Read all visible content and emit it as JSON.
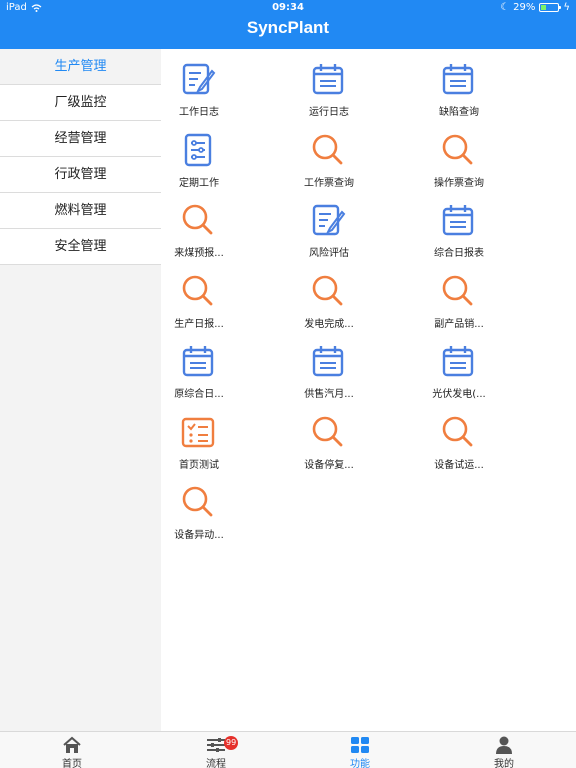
{
  "status_bar": {
    "device": "iPad",
    "time": "09:34",
    "battery": "29%",
    "battery_level": 0.29
  },
  "header": {
    "title": "SyncPlant"
  },
  "sidebar": {
    "items": [
      {
        "label": "生产管理",
        "active": true
      },
      {
        "label": "厂级监控"
      },
      {
        "label": "经营管理"
      },
      {
        "label": "行政管理"
      },
      {
        "label": "燃料管理"
      },
      {
        "label": "安全管理"
      }
    ]
  },
  "tiles": [
    {
      "label": "工作日志",
      "icon": "doc-edit-icon"
    },
    {
      "label": "运行日志",
      "icon": "calendar-icon"
    },
    {
      "label": "缺陷查询",
      "icon": "calendar-icon"
    },
    {
      "label": "定期工作",
      "icon": "checklist-doc-icon"
    },
    {
      "label": "工作票查询",
      "icon": "search-icon"
    },
    {
      "label": "操作票查询",
      "icon": "search-icon"
    },
    {
      "label": "来煤预报...",
      "icon": "search-icon"
    },
    {
      "label": "风险评估",
      "icon": "doc-edit-icon"
    },
    {
      "label": "综合日报表",
      "icon": "calendar-icon"
    },
    {
      "label": "生产日报...",
      "icon": "search-icon"
    },
    {
      "label": "发电完成...",
      "icon": "search-icon"
    },
    {
      "label": "副产品销...",
      "icon": "search-icon"
    },
    {
      "label": "原综合日...",
      "icon": "calendar-icon"
    },
    {
      "label": "供售汽月...",
      "icon": "calendar-icon"
    },
    {
      "label": "光伏发电(...",
      "icon": "calendar-icon"
    },
    {
      "label": "首页测试",
      "icon": "task-list-icon"
    },
    {
      "label": "设备停复...",
      "icon": "search-icon"
    },
    {
      "label": "设备试运...",
      "icon": "search-icon"
    },
    {
      "label": "设备异动...",
      "icon": "search-icon"
    }
  ],
  "colors": {
    "brand": "#2189f3",
    "icon_blue": "#4a7fe0",
    "icon_orange": "#f07e3f",
    "badge": "#e5312b"
  },
  "tabbar": {
    "items": [
      {
        "label": "首页",
        "icon": "home-icon"
      },
      {
        "label": "流程",
        "icon": "sliders-icon",
        "badge": "99"
      },
      {
        "label": "功能",
        "icon": "grid-icon",
        "active": true
      },
      {
        "label": "我的",
        "icon": "user-icon"
      }
    ]
  }
}
